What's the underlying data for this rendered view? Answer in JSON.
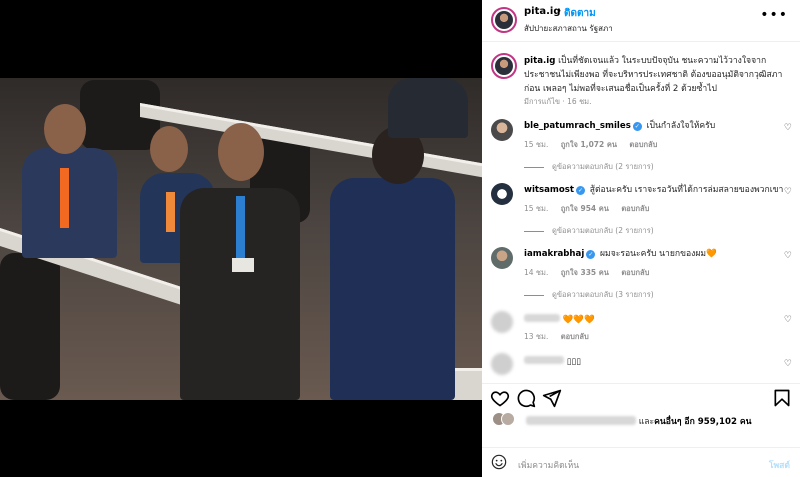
{
  "post": {
    "username": "pita.ig",
    "separator": "•",
    "follow_label": "ติดตาม",
    "location": "สัปปายะสภาสถาน รัฐสภา",
    "more_label": "•••"
  },
  "caption": {
    "username": "pita.ig",
    "text": "เป็นที่ชัดเจนแล้ว ในระบบปัจจุบัน ชนะความไว้วางใจจากประชาชนไม่เพียงพอ ที่จะบริหารประเทศชาติ ต้องขออนุมัติจากวุฒิสภาก่อน เพลอๆ ไม่พอที่จะเสนอชื่อเป็นครั้งที่ 2 ด้วยซ้ำไป",
    "meta": "มีการแก้ไข · 16 ชม."
  },
  "comments": [
    {
      "username": "ble_patumrach_smiles",
      "verified": true,
      "text": "เป็นกำลังใจให้ครับ",
      "time": "15 ชม.",
      "likes": "ถูกใจ 1,072 คน",
      "reply": "ตอบกลับ",
      "replies": "ดูข้อความตอบกลับ (2 รายการ)"
    },
    {
      "username": "witsamost",
      "verified": true,
      "text": "สู้ต่อนะครับ เราจะรอวันที่ได้การล่มสลายของพวกเขา",
      "time": "15 ชม.",
      "likes": "ถูกใจ 954 คน",
      "reply": "ตอบกลับ",
      "replies": "ดูข้อความตอบกลับ (2 รายการ)"
    },
    {
      "username": "iamakrabhaj",
      "verified": true,
      "text": "ผมจะรอนะครับ นายกของผม🧡",
      "time": "14 ชม.",
      "likes": "ถูกใจ 335 คน",
      "reply": "ตอบกลับ",
      "replies": "ดูข้อความตอบกลับ (3 รายการ)"
    },
    {
      "username": "",
      "verified": false,
      "text": "🧡🧡🧡",
      "time": "13 ชม.",
      "likes": "",
      "reply": "ตอบกลับ",
      "replies": ""
    },
    {
      "username": "",
      "verified": false,
      "text": "▯▯▯",
      "time": "",
      "likes": "",
      "reply": "",
      "replies": ""
    }
  ],
  "likes_summary": {
    "prefix": "และ",
    "others": "คนอื่นๆ อีก 959,102 คน"
  },
  "time_ago": "",
  "add_comment": {
    "placeholder": "เพิ่มความคิดเห็น",
    "post_label": "โพสต์"
  },
  "colors": {
    "accent": "#0095f6",
    "verified": "#3897f0",
    "muted": "#8e8e8e",
    "post_disabled": "#b2dffc"
  },
  "icons": [
    "heart-icon",
    "comment-icon",
    "share-icon",
    "bookmark-icon",
    "emoji-icon",
    "more-icon",
    "verified-icon"
  ]
}
